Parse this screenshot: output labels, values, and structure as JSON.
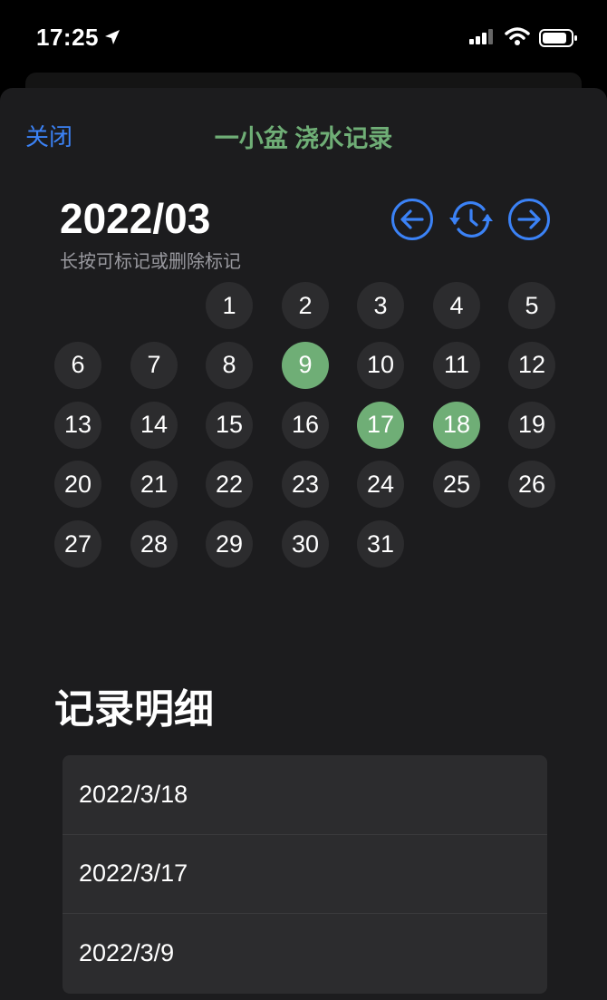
{
  "status_bar": {
    "time": "17:25"
  },
  "nav": {
    "close_label": "关闭",
    "title": "一小盆 浇水记录"
  },
  "calendar": {
    "month_title": "2022/03",
    "hint": "长按可标记或删除标记",
    "first_weekday_index": 2,
    "days": [
      "1",
      "2",
      "3",
      "4",
      "5",
      "6",
      "7",
      "8",
      "9",
      "10",
      "11",
      "12",
      "13",
      "14",
      "15",
      "16",
      "17",
      "18",
      "19",
      "20",
      "21",
      "22",
      "23",
      "24",
      "25",
      "26",
      "27",
      "28",
      "29",
      "30",
      "31"
    ],
    "marked_days": [
      "9",
      "17",
      "18"
    ]
  },
  "records": {
    "title": "记录明细",
    "items": [
      "2022/3/18",
      "2022/3/17",
      "2022/3/9"
    ]
  },
  "colors": {
    "accent": "#3b82f6",
    "marked": "#6fae76",
    "cell": "#2c2c2e",
    "sheet": "#1c1c1e"
  }
}
